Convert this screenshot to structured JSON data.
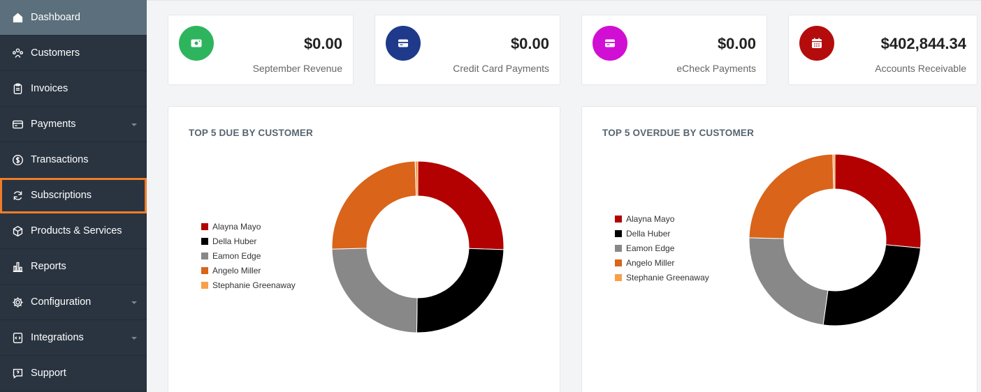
{
  "sidebar": {
    "items": [
      {
        "label": "Dashboard",
        "icon": "home-icon"
      },
      {
        "label": "Customers",
        "icon": "customers-icon"
      },
      {
        "label": "Invoices",
        "icon": "clipboard-icon"
      },
      {
        "label": "Payments",
        "icon": "credit-card-icon"
      },
      {
        "label": "Transactions",
        "icon": "dollar-circle-icon"
      },
      {
        "label": "Subscriptions",
        "icon": "refresh-icon"
      },
      {
        "label": "Products & Services",
        "icon": "box-icon"
      },
      {
        "label": "Reports",
        "icon": "bar-chart-icon"
      },
      {
        "label": "Configuration",
        "icon": "gear-icon"
      },
      {
        "label": "Integrations",
        "icon": "code-icon"
      },
      {
        "label": "Support",
        "icon": "chat-help-icon"
      }
    ]
  },
  "stats": [
    {
      "value": "$0.00",
      "label": "September Revenue",
      "color": "#2fb45e",
      "icon": "cash-icon"
    },
    {
      "value": "$0.00",
      "label": "Credit Card Payments",
      "color": "#1f3a8a",
      "icon": "credit-card-icon"
    },
    {
      "value": "$0.00",
      "label": "eCheck Payments",
      "color": "#d10fd4",
      "icon": "credit-card-icon"
    },
    {
      "value": "$402,844.34",
      "label": "Accounts Receivable",
      "color": "#b40c0c",
      "icon": "calendar-icon"
    }
  ],
  "charts": [
    {
      "title": "TOP 5 DUE BY CUSTOMER"
    },
    {
      "title": "TOP 5 OVERDUE BY CUSTOMER"
    }
  ],
  "chart_data": [
    {
      "type": "pie",
      "title": "TOP 5 DUE BY CUSTOMER",
      "legend": "left",
      "categories": [
        "Alayna Mayo",
        "Della Huber",
        "Eamon Edge",
        "Angelo Miller",
        "Stephanie Greenaway"
      ],
      "values": [
        0.255,
        0.247,
        0.244,
        0.249,
        0.005
      ],
      "colors": [
        "#b30000",
        "#000000",
        "#888888",
        "#d9641a",
        "#f7a04a"
      ]
    },
    {
      "type": "pie",
      "title": "TOP 5 OVERDUE BY CUSTOMER",
      "legend": "left",
      "categories": [
        "Alayna Mayo",
        "Della Huber",
        "Eamon Edge",
        "Angelo Miller",
        "Stephanie Greenaway"
      ],
      "values": [
        0.265,
        0.257,
        0.232,
        0.242,
        0.004
      ],
      "colors": [
        "#b30000",
        "#000000",
        "#888888",
        "#d9641a",
        "#f7a04a"
      ]
    }
  ]
}
